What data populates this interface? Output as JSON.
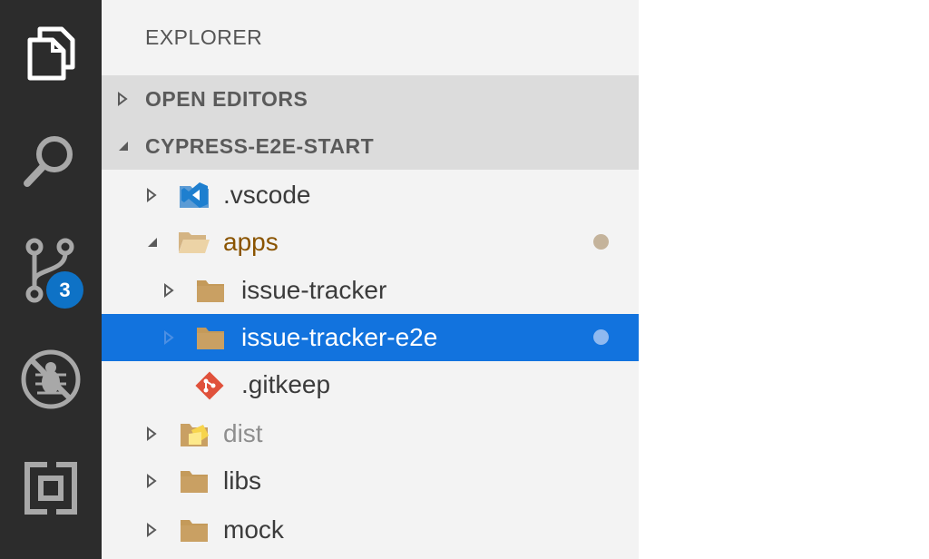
{
  "activity_bar": {
    "scm_badge": "3"
  },
  "explorer": {
    "title": "EXPLORER",
    "sections": {
      "open_editors": "OPEN EDITORS",
      "workspace": "CYPRESS-E2E-START"
    },
    "tree": {
      "vscode": ".vscode",
      "apps": "apps",
      "issue_tracker": "issue-tracker",
      "issue_tracker_e2e": "issue-tracker-e2e",
      "gitkeep": ".gitkeep",
      "dist": "dist",
      "libs": "libs",
      "mock": "mock"
    }
  },
  "colors": {
    "activity_bg": "#2c2c2c",
    "sidebar_bg": "#f3f3f3",
    "section_bg": "#dcdcdc",
    "selection": "#1273de",
    "badge": "#0e72c6",
    "modified_text": "#8a5400",
    "modified_dot": "#c4b39b",
    "selected_dot": "#8fb9f0"
  }
}
